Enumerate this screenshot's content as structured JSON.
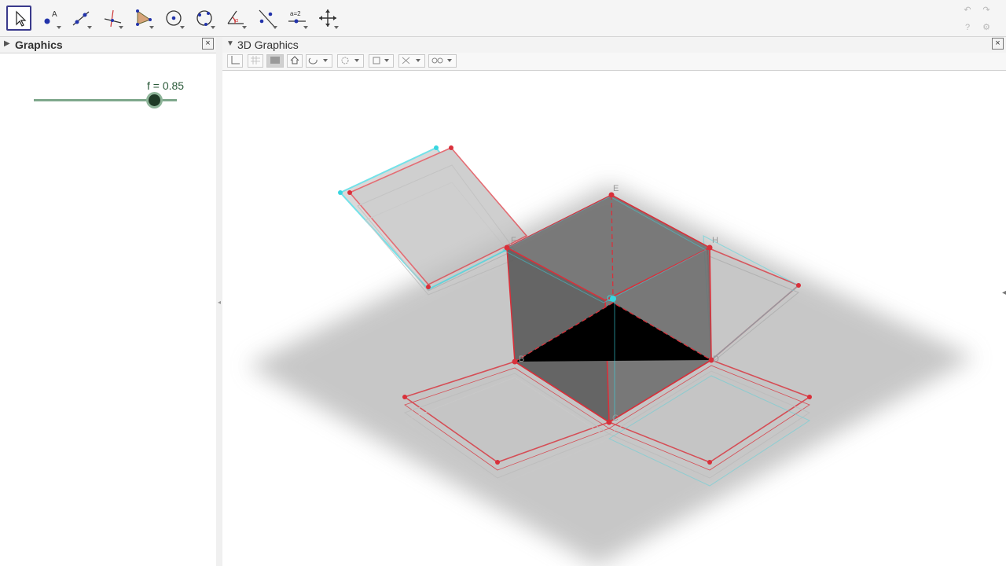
{
  "toolbar": {
    "tools": [
      {
        "name": "move-tool"
      },
      {
        "name": "point-tool"
      },
      {
        "name": "line-tool"
      },
      {
        "name": "perpendicular-line-tool"
      },
      {
        "name": "polygon-tool"
      },
      {
        "name": "circle-tool"
      },
      {
        "name": "circle-three-points-tool"
      },
      {
        "name": "angle-tool"
      },
      {
        "name": "reflect-tool"
      },
      {
        "name": "slider-tool"
      },
      {
        "name": "move-graphics-view-tool"
      }
    ],
    "slider_tool_text": "a=2"
  },
  "graphics_panel": {
    "title": "Graphics",
    "close": "×",
    "slider": {
      "label": "f = 0.85",
      "value": 0.85
    }
  },
  "graphics3d_panel": {
    "title": "3D Graphics",
    "close": "×"
  },
  "scene": {
    "point_labels": {
      "E": "E",
      "F": "F",
      "H": "H",
      "G": "G",
      "B": "B",
      "C": "C",
      "D": "D"
    },
    "colors": {
      "red": "#d9303a",
      "cyan": "#39d6e0",
      "cube": "#5a5a5a",
      "shadow": "#9a9a9a"
    }
  }
}
